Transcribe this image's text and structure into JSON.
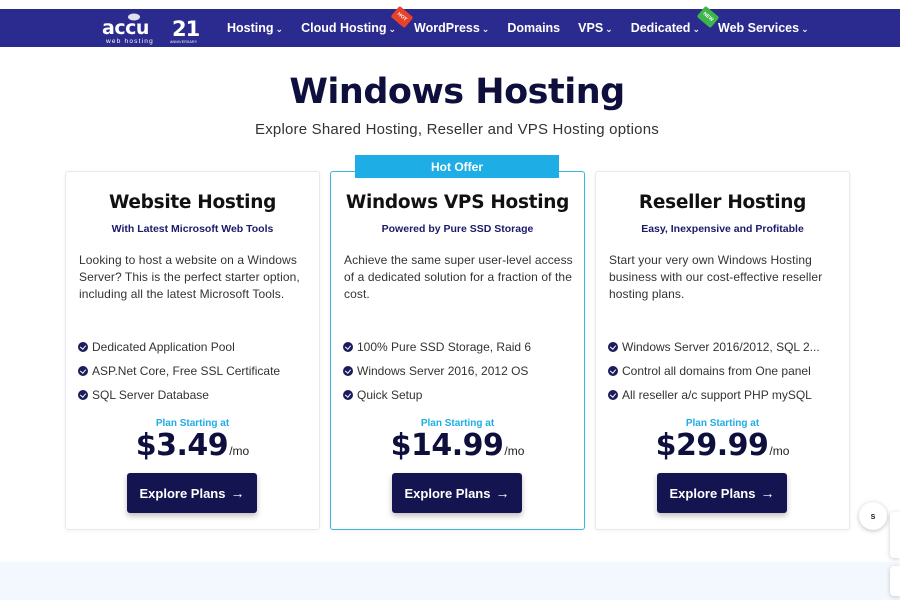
{
  "brand": {
    "name": "accu",
    "tagline": "web hosting",
    "anniversary_number": "21",
    "anniversary_text": "ANNIVERSARY"
  },
  "nav": {
    "items": [
      {
        "label": "Hosting",
        "has_dropdown": true,
        "badge": ""
      },
      {
        "label": "Cloud Hosting",
        "has_dropdown": true,
        "badge": "HOT"
      },
      {
        "label": "WordPress",
        "has_dropdown": true,
        "badge": ""
      },
      {
        "label": "Domains",
        "has_dropdown": false,
        "badge": ""
      },
      {
        "label": "VPS",
        "has_dropdown": true,
        "badge": ""
      },
      {
        "label": "Dedicated",
        "has_dropdown": true,
        "badge": "NEW"
      },
      {
        "label": "Web Services",
        "has_dropdown": true,
        "badge": ""
      }
    ]
  },
  "page": {
    "title": "Windows Hosting",
    "subtitle": "Explore Shared Hosting, Reseller and VPS Hosting options"
  },
  "cards": [
    {
      "title": "Website Hosting",
      "tagline": "With Latest Microsoft Web Tools",
      "description": "Looking to host a website on a Windows Server? This is the perfect starter option, including all the latest Microsoft Tools.",
      "features": [
        "Dedicated Application Pool",
        "ASP.Net Core, Free SSL Certificate",
        "SQL Server Database"
      ],
      "plan_label": "Plan Starting at",
      "price": "$3.49",
      "period": "/mo",
      "button_label": "Explore Plans"
    },
    {
      "ribbon": "Hot Offer",
      "title": "Windows VPS Hosting",
      "tagline": "Powered by Pure SSD Storage",
      "description": "Achieve the same super user-level access of a dedicated solution for a fraction of the cost.",
      "features": [
        "100% Pure SSD Storage, Raid 6",
        "Windows Server 2016, 2012 OS",
        "Quick Setup"
      ],
      "plan_label": "Plan Starting at",
      "price": "$14.99",
      "period": "/mo",
      "button_label": "Explore Plans"
    },
    {
      "title": "Reseller Hosting",
      "tagline": "Easy, Inexpensive and Profitable",
      "description": "Start your very own Windows Hosting business with our cost-effective reseller hosting plans.",
      "features": [
        "Windows Server 2016/2012, SQL 2...",
        "Control all domains from One panel",
        "All reseller a/c support PHP mySQL"
      ],
      "plan_label": "Plan Starting at",
      "price": "$29.99",
      "period": "/mo",
      "button_label": "Explore Plans"
    }
  ],
  "floating": {
    "circle_label": "s"
  },
  "icons": {
    "check": "check-circle-icon",
    "arrow": "arrow-right-icon",
    "chevron": "chevron-down-icon"
  },
  "colors": {
    "nav_bg": "#2b2a8f",
    "accent": "#1eaee5",
    "button_bg": "#141450",
    "title": "#0f0f3d",
    "hot_badge": "#e8432a",
    "new_badge": "#3db54a"
  }
}
